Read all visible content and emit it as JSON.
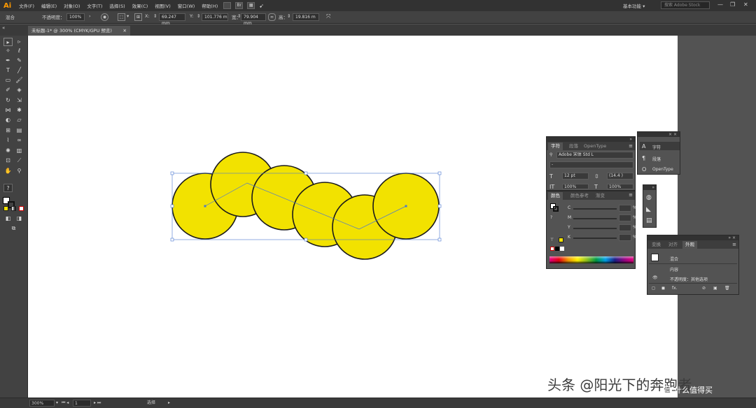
{
  "app": {
    "logo": "Ai",
    "menu": [
      "文件(F)",
      "编辑(E)",
      "对象(O)",
      "文字(T)",
      "选择(S)",
      "效果(C)",
      "视图(V)",
      "窗口(W)",
      "帮助(H)"
    ],
    "bridge_label": "Br",
    "workspace": "基本功能",
    "search_placeholder": "搜索 Adobe Stock",
    "window_buttons": [
      "—",
      "❐",
      "✕"
    ]
  },
  "control_bar": {
    "selection_label": "混合",
    "opacity_label": "不透明度：",
    "opacity_value": "100%",
    "x_label": "X:",
    "x_value": "69.247 mm",
    "y_label": "Y:",
    "y_value": "101.776 m",
    "w_label": "宽：",
    "w_value": "79.904 mm",
    "h_label": "高：",
    "h_value": "19.816 m"
  },
  "document": {
    "tab_title": "未标题-1* @ 300% (CMYK/GPU 预览)",
    "tab_close": "✕"
  },
  "status_bar": {
    "zoom": "300%",
    "page": "1",
    "tool": "选择"
  },
  "watermark": "头条 @阳光下的奔跑者",
  "badge": "什么值得买",
  "badge_icon": "值",
  "colors": {
    "circle_fill": "#f2e200",
    "circle_stroke": "#1a1a1a",
    "selection_blue": "#4b78d0",
    "ui_dark": "#323232",
    "ui_mid": "#535353"
  },
  "panels": {
    "character": {
      "tabs": [
        "字符",
        "段落",
        "OpenType"
      ],
      "font_family": "Adobe 宋体 Std L",
      "font_style": "-",
      "font_size": "12 pt",
      "leading": "(14.4 )",
      "scale_v": "100%",
      "scale_h": "100%"
    },
    "color": {
      "tabs": [
        "颜色",
        "颜色参考",
        "渐变"
      ],
      "channels": [
        "C",
        "M",
        "Y",
        "K"
      ],
      "percent": "%"
    },
    "character_mini": {
      "items": [
        "字符",
        "段落",
        "OpenType"
      ],
      "icons": [
        "A",
        "¶",
        "O"
      ]
    },
    "appearance": {
      "tabs": [
        "变换",
        "对齐",
        "外观"
      ],
      "object_label": "混合",
      "content_label": "内容",
      "opacity_row": "不透明度：其他选项",
      "fx_label": "fx."
    }
  }
}
